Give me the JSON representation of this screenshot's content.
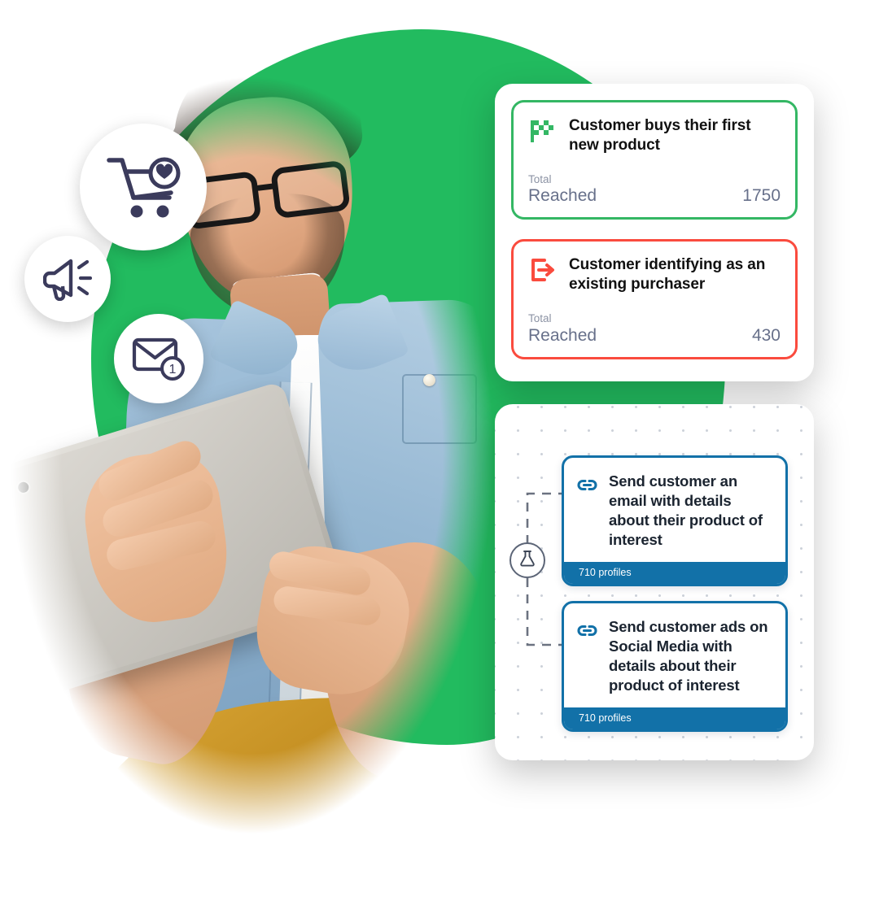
{
  "theme": {
    "green": "#22BB5F",
    "card_green": "#34B764",
    "card_red": "#FA4B3E",
    "node_blue": "#1271A8",
    "muted": "#8c93a4",
    "value": "#67708a"
  },
  "photo": {
    "alt": "Smiling man with glasses in denim shirt holding a tablet"
  },
  "badges": [
    {
      "icon": "shopping-cart-heart-icon",
      "name": "cart-badge"
    },
    {
      "icon": "megaphone-icon",
      "name": "megaphone-badge"
    },
    {
      "icon": "envelope-icon",
      "name": "mail-badge",
      "count": "1"
    }
  ],
  "stats_panel": {
    "cards": [
      {
        "icon": "checkered-flag-icon",
        "accent": "#34B764",
        "title": "Customer buys their first new product",
        "metric_small": "Total",
        "metric_label": "Reached",
        "metric_value": "1750"
      },
      {
        "icon": "exit-arrow-icon",
        "accent": "#FA4B3E",
        "title": "Customer identifying as an existing purchaser",
        "metric_small": "Total",
        "metric_label": "Reached",
        "metric_value": "430"
      }
    ]
  },
  "flow_panel": {
    "split_node": {
      "icon": "flask-icon",
      "name": "ab-split-node"
    },
    "nodes": [
      {
        "icon": "link-icon",
        "title": "Send customer an email with details about their product of interest",
        "footer": "710 profiles"
      },
      {
        "icon": "link-icon",
        "title": "Send customer ads on Social Media with details about their product of interest",
        "footer": "710 profiles"
      }
    ]
  }
}
